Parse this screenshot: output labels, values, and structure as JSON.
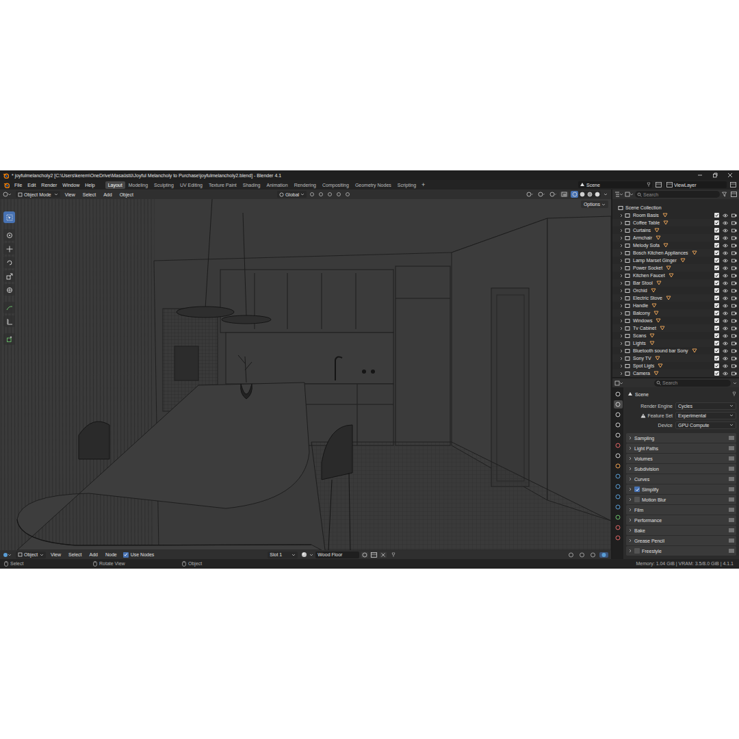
{
  "window": {
    "title": "* joyfulmelancholy2 [C:\\Users\\kerem\\OneDrive\\Masaüstü\\Joyful Melancholy to Purchase\\joyfulmelancholy2.blend] - Blender 4.1"
  },
  "menu": [
    "File",
    "Edit",
    "Render",
    "Window",
    "Help"
  ],
  "workspaces": [
    {
      "label": "Layout",
      "selected": true
    },
    {
      "label": "Modeling",
      "selected": false
    },
    {
      "label": "Sculpting",
      "selected": false
    },
    {
      "label": "UV Editing",
      "selected": false
    },
    {
      "label": "Texture Paint",
      "selected": false
    },
    {
      "label": "Shading",
      "selected": false
    },
    {
      "label": "Animation",
      "selected": false
    },
    {
      "label": "Rendering",
      "selected": false
    },
    {
      "label": "Compositing",
      "selected": false
    },
    {
      "label": "Geometry Nodes",
      "selected": false
    },
    {
      "label": "Scripting",
      "selected": false
    }
  ],
  "add_workspace": "+",
  "scene": "Scene",
  "view_layer": "ViewLayer",
  "viewport": {
    "mode": "Object Mode",
    "menus": [
      "View",
      "Select",
      "Add",
      "Object"
    ],
    "orientation": "Global",
    "options": "Options",
    "shading": [
      {
        "selected": true
      },
      {
        "selected": false
      },
      {
        "selected": false
      },
      {
        "selected": false
      }
    ],
    "tools": [
      {
        "selected": true
      },
      {
        "selected": false
      },
      {
        "selected": false
      },
      {
        "selected": false
      },
      {
        "selected": false
      },
      {
        "selected": false
      },
      {
        "selected": false
      },
      {
        "selected": false
      },
      {
        "selected": false
      }
    ]
  },
  "outliner": {
    "search": {
      "placeholder": "Search"
    },
    "root": "Scene Collection",
    "items": [
      {
        "name": "Room Basis",
        "included": true
      },
      {
        "name": "Coffee Table",
        "included": true
      },
      {
        "name": "Curtains",
        "included": true
      },
      {
        "name": "Armchair",
        "included": true
      },
      {
        "name": "Melody Sofa",
        "included": true
      },
      {
        "name": "Bosch Kitchen Appliances",
        "included": true
      },
      {
        "name": "Lamp Marset Ginger",
        "included": true
      },
      {
        "name": "Power Socket",
        "included": true
      },
      {
        "name": "Kitchen Faucet",
        "included": true
      },
      {
        "name": "Bar Stool",
        "included": true
      },
      {
        "name": "Orchid",
        "included": true
      },
      {
        "name": "Electric Stove",
        "included": true
      },
      {
        "name": "Handle",
        "included": true
      },
      {
        "name": "Balcony",
        "included": true
      },
      {
        "name": "Windows",
        "included": true
      },
      {
        "name": "Tv Cabinet",
        "included": true
      },
      {
        "name": "Scans",
        "included": true
      },
      {
        "name": "Lights",
        "included": true
      },
      {
        "name": "Bluetooth sound bar Sony",
        "included": true
      },
      {
        "name": "Sony TV",
        "included": true
      },
      {
        "name": "Spot Ligts",
        "included": true
      },
      {
        "name": "Camera",
        "included": true
      }
    ]
  },
  "properties": {
    "search": {
      "placeholder": "Search"
    },
    "title": "Scene",
    "tabs": [
      {
        "selected": false
      },
      {
        "selected": true
      },
      {
        "selected": false
      },
      {
        "selected": false
      },
      {
        "selected": false
      },
      {
        "selected": false
      },
      {
        "selected": false
      },
      {
        "selected": false
      },
      {
        "selected": false
      },
      {
        "selected": false
      },
      {
        "selected": false
      },
      {
        "selected": false
      },
      {
        "selected": false
      },
      {
        "selected": false
      },
      {
        "selected": false
      }
    ],
    "fields": [
      {
        "label": "Render Engine",
        "value": "Cycles",
        "warning": false
      },
      {
        "label": "Feature Set",
        "value": "Experimental",
        "warning": true
      },
      {
        "label": "Device",
        "value": "GPU Compute",
        "warning": false
      }
    ],
    "panels": [
      {
        "label": "Sampling",
        "kind": "plain",
        "checked": false,
        "presets": false
      },
      {
        "label": "Light Paths",
        "kind": "plain",
        "checked": false,
        "presets": true
      },
      {
        "label": "Volumes",
        "kind": "plain",
        "checked": false,
        "presets": false
      },
      {
        "label": "Subdivision",
        "kind": "plain",
        "checked": false,
        "presets": false
      },
      {
        "label": "Curves",
        "kind": "plain",
        "checked": false,
        "presets": false
      },
      {
        "label": "Simplify",
        "kind": "check",
        "checked": true,
        "presets": false
      },
      {
        "label": "Motion Blur",
        "kind": "check",
        "checked": false,
        "presets": false
      },
      {
        "label": "Film",
        "kind": "plain",
        "checked": false,
        "presets": false
      },
      {
        "label": "Performance",
        "kind": "plain",
        "checked": false,
        "presets": true
      },
      {
        "label": "Bake",
        "kind": "plain",
        "checked": false,
        "presets": false
      },
      {
        "label": "Grease Pencil",
        "kind": "plain",
        "checked": false,
        "presets": false
      },
      {
        "label": "Freestyle",
        "kind": "check",
        "checked": false,
        "presets": false
      }
    ]
  },
  "shader_header": {
    "mode": "Object",
    "menus": [
      "View",
      "Select",
      "Add",
      "Node"
    ],
    "use_nodes": {
      "label": "Use Nodes",
      "checked": true
    },
    "slot": "Slot 1",
    "material": "Wood Floor"
  },
  "status_bar": {
    "hints": [
      "Select",
      "Rotate View",
      "Object"
    ],
    "info": "Memory: 1.04 GiB | VRAM: 3.5/8.0 GiB | 4.1.1"
  }
}
